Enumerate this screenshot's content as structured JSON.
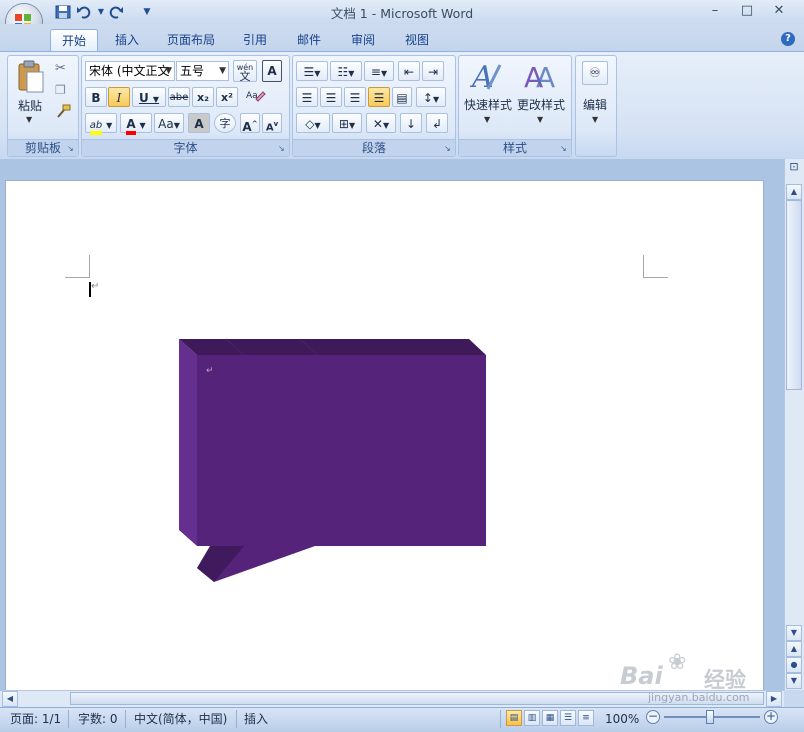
{
  "window": {
    "title": "文档 1 - Microsoft Word"
  },
  "quick_access": {
    "save": "save-icon",
    "undo": "undo-icon",
    "redo": "redo-icon",
    "customize": "▼"
  },
  "tabs": [
    {
      "label": "开始",
      "active": true
    },
    {
      "label": "插入"
    },
    {
      "label": "页面布局"
    },
    {
      "label": "引用"
    },
    {
      "label": "邮件"
    },
    {
      "label": "审阅"
    },
    {
      "label": "视图"
    }
  ],
  "ribbon": {
    "clipboard": {
      "paste_label": "粘贴",
      "group_label": "剪贴板"
    },
    "font": {
      "font_name": "宋体 (中文正文",
      "font_size": "五号",
      "group_label": "字体",
      "bold": "B",
      "italic": "I",
      "underline": "U",
      "strike": "abe",
      "sub": "x₂",
      "sup": "x²",
      "highlight": "ab",
      "font_color": "A",
      "change_case": "Aa",
      "char_shading": "A",
      "enclose": "字",
      "grow": "A",
      "shrink": "A",
      "phonetic_top": "wén",
      "phonetic_bottom": "文",
      "char_border": "A"
    },
    "paragraph": {
      "group_label": "段落"
    },
    "styles": {
      "quick_styles_label": "快速样式",
      "change_styles_label": "更改样式",
      "group_label": "样式"
    },
    "editing": {
      "label": "编辑"
    }
  },
  "status_bar": {
    "page": "页面: 1/1",
    "words": "字数: 0",
    "language": "中文(简体，中国)",
    "mode": "插入",
    "zoom": "100%"
  },
  "colors": {
    "shape_fill": "#552379",
    "shape_side": "#652f8f",
    "shape_top": "#3e1a5a",
    "accent": "#15428b"
  },
  "watermark": {
    "line1": "Bai",
    "line2": "经验",
    "url": "jingyan.baidu.com"
  }
}
